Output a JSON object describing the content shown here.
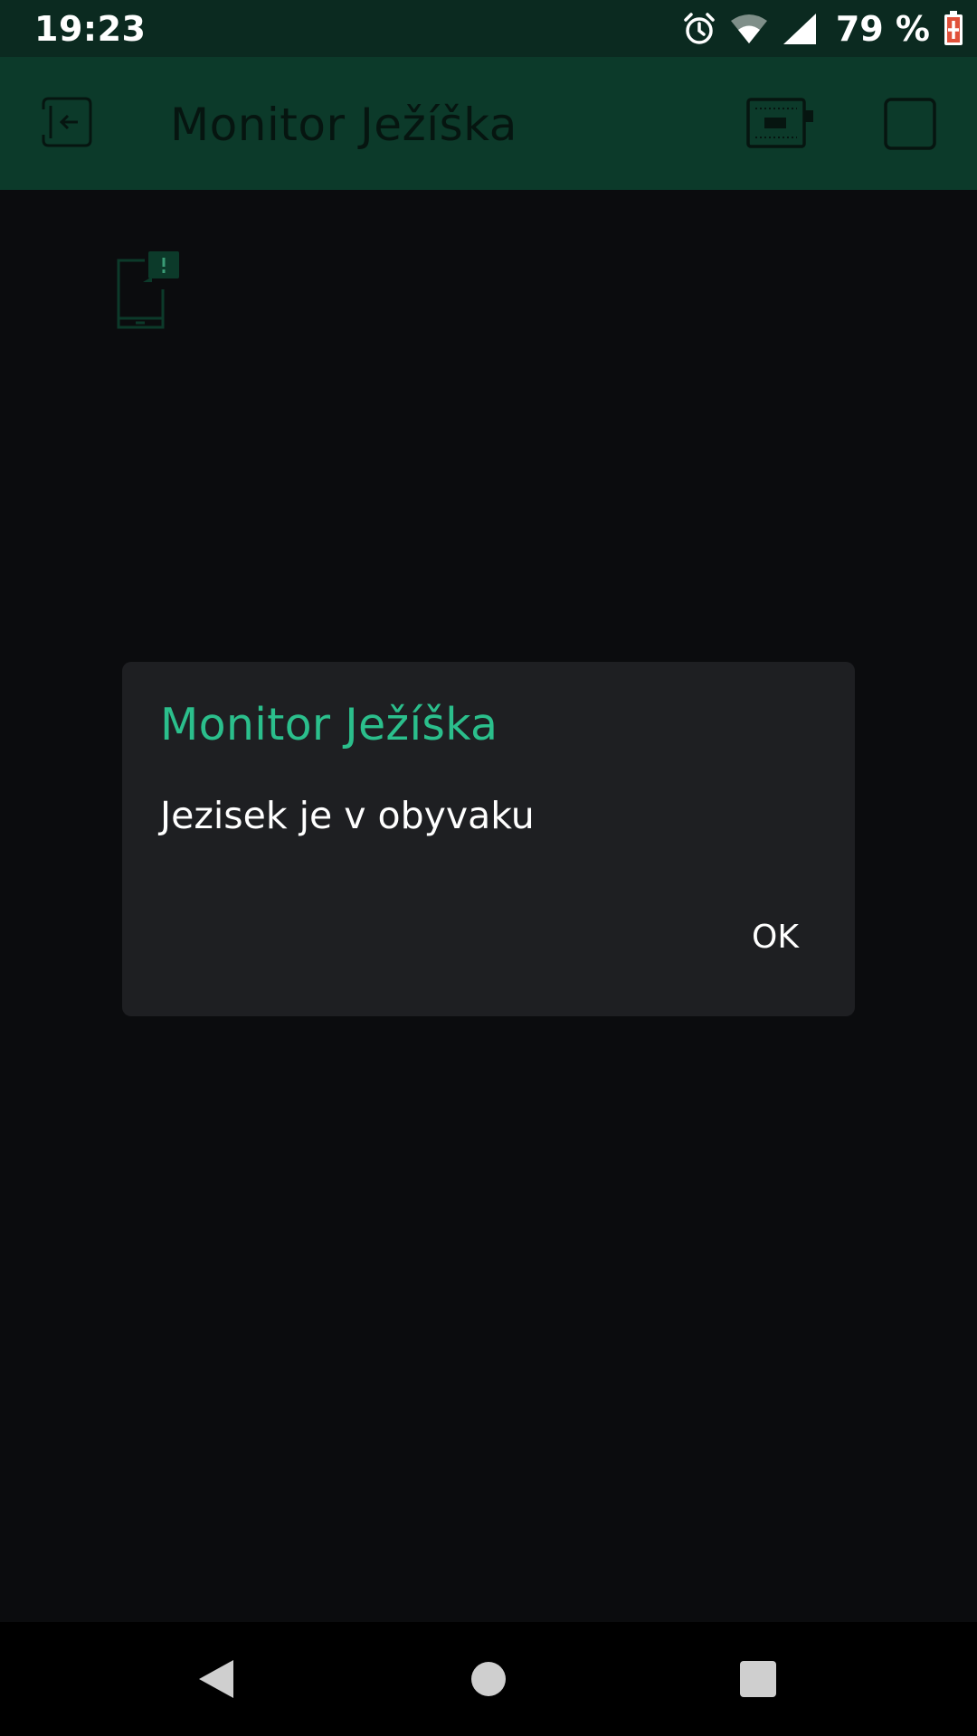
{
  "status_bar": {
    "time": "19:23",
    "battery_percent": "79 %",
    "icons": [
      "alarm-icon",
      "wifi-icon",
      "cellular-signal-icon",
      "battery-charging-icon"
    ]
  },
  "app_bar": {
    "title": "Monitor Ježíška",
    "icons": [
      "exit-project-icon",
      "device-hardware-icon",
      "stop-square-icon"
    ]
  },
  "content": {
    "indicator_icon": "phone-alert-icon"
  },
  "dialog": {
    "title": "Monitor Ježíška",
    "message": "Jezisek je v obyvaku",
    "ok_label": "OK"
  },
  "nav_bar": {
    "icons": [
      "back-icon",
      "home-icon",
      "recents-icon"
    ]
  },
  "colors": {
    "status_bar_bg": "#0b2a20",
    "app_bar_bg": "#0c3a2a",
    "background": "#0b0c0e",
    "dialog_bg": "#1e1f22",
    "accent": "#2bbf8c"
  }
}
